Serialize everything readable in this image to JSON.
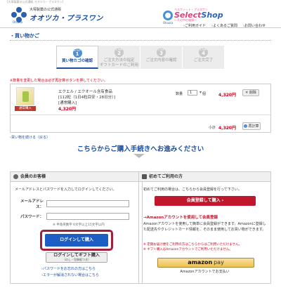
{
  "top_strip": "[大塚製薬の公式通販 オオツカ・プラスワン]",
  "header": {
    "brand_sub": "大塚製薬の公式通販",
    "brand_name": "オオツカ・プラスワン",
    "brand_small": "Otsuka",
    "selectshop_top": "ベルフィット・プラスワン",
    "selectshop_select": "Select",
    "selectshop_shop": "Shop",
    "selectshop_bottom": "～その中の価値～",
    "selectshop_small": "Otsuka",
    "nav": [
      "ご利用ガイド",
      "よくあるご質問",
      "お問い合わせ"
    ]
  },
  "cart_heading": "買い物かご",
  "steps": [
    {
      "step_word": "STEP",
      "num": "1",
      "label": "買い物カゴの確認",
      "active": true
    },
    {
      "step_word": "STEP",
      "num": "2",
      "label": "ご注文方法の指定\nギフトカードのご利用",
      "active": false
    },
    {
      "step_word": "STEP",
      "num": "3",
      "label": "ご注文内容の確認",
      "active": false
    },
    {
      "step_word": "STEP",
      "num": "4",
      "label": "ご注文完了",
      "active": false
    }
  ],
  "notice": "※数量を変更した場合は必ず再計算ボタンを押してください。",
  "cart": {
    "badge": "通常購入",
    "product_name": "エクエル / エクオール含有食品",
    "product_detail": "[112粒（1日4粒目安・28日分）]",
    "product_type": "[通常購入]",
    "unit_price": "4,320円",
    "qty_label": "数量",
    "qty_value": "1",
    "qty_unit": "個",
    "row_price": "4,320円",
    "delete_label": "削除",
    "subtotal_label": "小計",
    "subtotal_value": "4,320円",
    "recalc_label": "再計算"
  },
  "continue_link": "買い物を続ける（戻る）",
  "proceed_heading": "こちらからご購入手続きへお進みください",
  "member_panel": {
    "title": "会員のお客様",
    "desc": "メールアドレスとパスワードを入力してログインしてください。",
    "email_label": "メールアドレス：",
    "password_label": "パスワード：",
    "hint": "※ 半角英数字 6文字以上15文字以内",
    "login_button": "ログインして購入",
    "gift_button_line1": "ログインしてギフト購入",
    "gift_button_line2": "（のし・包装紙つき）",
    "help_links": [
      "パスワードをお忘れの方はこちら",
      "エラーが解消されない場合はこちら"
    ]
  },
  "new_panel": {
    "title": "初めてご利用の方",
    "desc": "初めてご利用の場合は、こちらから会員登録を行って下さい。",
    "register_button": "会員登録して購入",
    "amazon_heading": "Amazonアカウントを使用して会員登録",
    "amazon_desc": "Amazonアカウントを使用して簡単に会員登録ができます。Amazonに登録した配送先やクレジットカード情報を、そのまま使用してお買い物ができます。",
    "amazon_note": "※ 定期お届け便をご利用の方はこちらからはご利用いただけません。\n※ ギフト購入はAmazonアカウントでご利用いただけません。",
    "amazon_logo_word": "amazon",
    "amazon_pay_word": "pay",
    "amazon_caption": "Amazonアカウントでお支払い"
  },
  "colors": {
    "brand_blue": "#1d4fa0",
    "price_red": "#d0021b",
    "register_red": "#c0172d",
    "highlight_border": "#a2203b",
    "amazon_yellow": "#f0c14b"
  }
}
